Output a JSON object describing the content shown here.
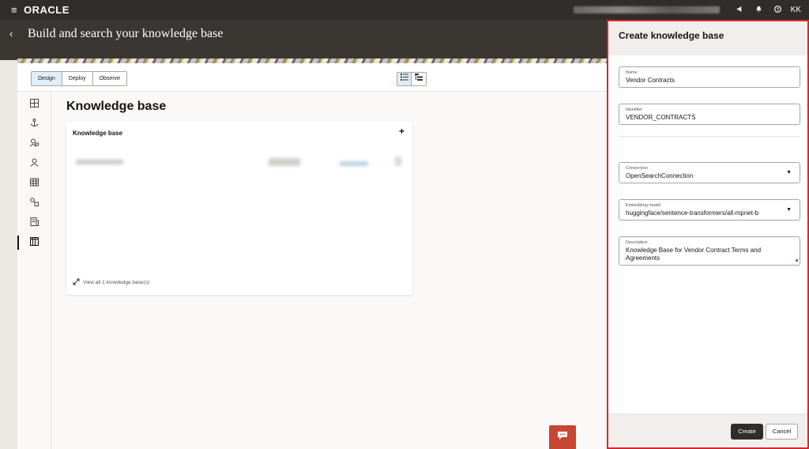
{
  "topbar": {
    "menu_icon": "≡",
    "logo": "ORACLE",
    "icons": [
      "megaphone-icon",
      "bell-icon",
      "help-icon"
    ],
    "user_initials": "KK"
  },
  "header": {
    "back_icon": "‹",
    "title": "Build and search your knowledge base"
  },
  "toolbar": {
    "tabs": [
      {
        "label": "Design",
        "active": true
      },
      {
        "label": "Deploy",
        "active": false
      },
      {
        "label": "Observe",
        "active": false
      }
    ]
  },
  "nav": {
    "items": [
      "dashboard-icon",
      "anchor-icon",
      "agent-icon",
      "user-icon",
      "table-icon",
      "shapes-icon",
      "report-icon",
      "library-icon"
    ],
    "selected_index": 7
  },
  "main": {
    "heading": "Knowledge base",
    "card": {
      "title": "Knowledge base",
      "add_label": "+",
      "view_all": "View all 1 knowledge base(s)"
    }
  },
  "panel": {
    "title": "Create knowledge base",
    "fields": {
      "name": {
        "label": "Name",
        "value": "Vendor Contracts"
      },
      "identifier": {
        "label": "Identifier",
        "value": "VENDOR_CONTRACTS"
      },
      "connection": {
        "label": "Connection",
        "value": "OpenSearchConnection"
      },
      "embedding": {
        "label": "Embedding model",
        "value": "huggingface/sentence-transformers/all-mpnet-b"
      },
      "description": {
        "label": "Description",
        "value": "Knowledge Base for Vendor Contract Terms and Agreements"
      }
    },
    "create_label": "Create",
    "cancel_label": "Cancel"
  },
  "colors": {
    "accent_red": "#c74634",
    "highlight_border": "#d9272e",
    "dark_bar": "#312d2a",
    "selected_tab": "#dfeef7"
  }
}
